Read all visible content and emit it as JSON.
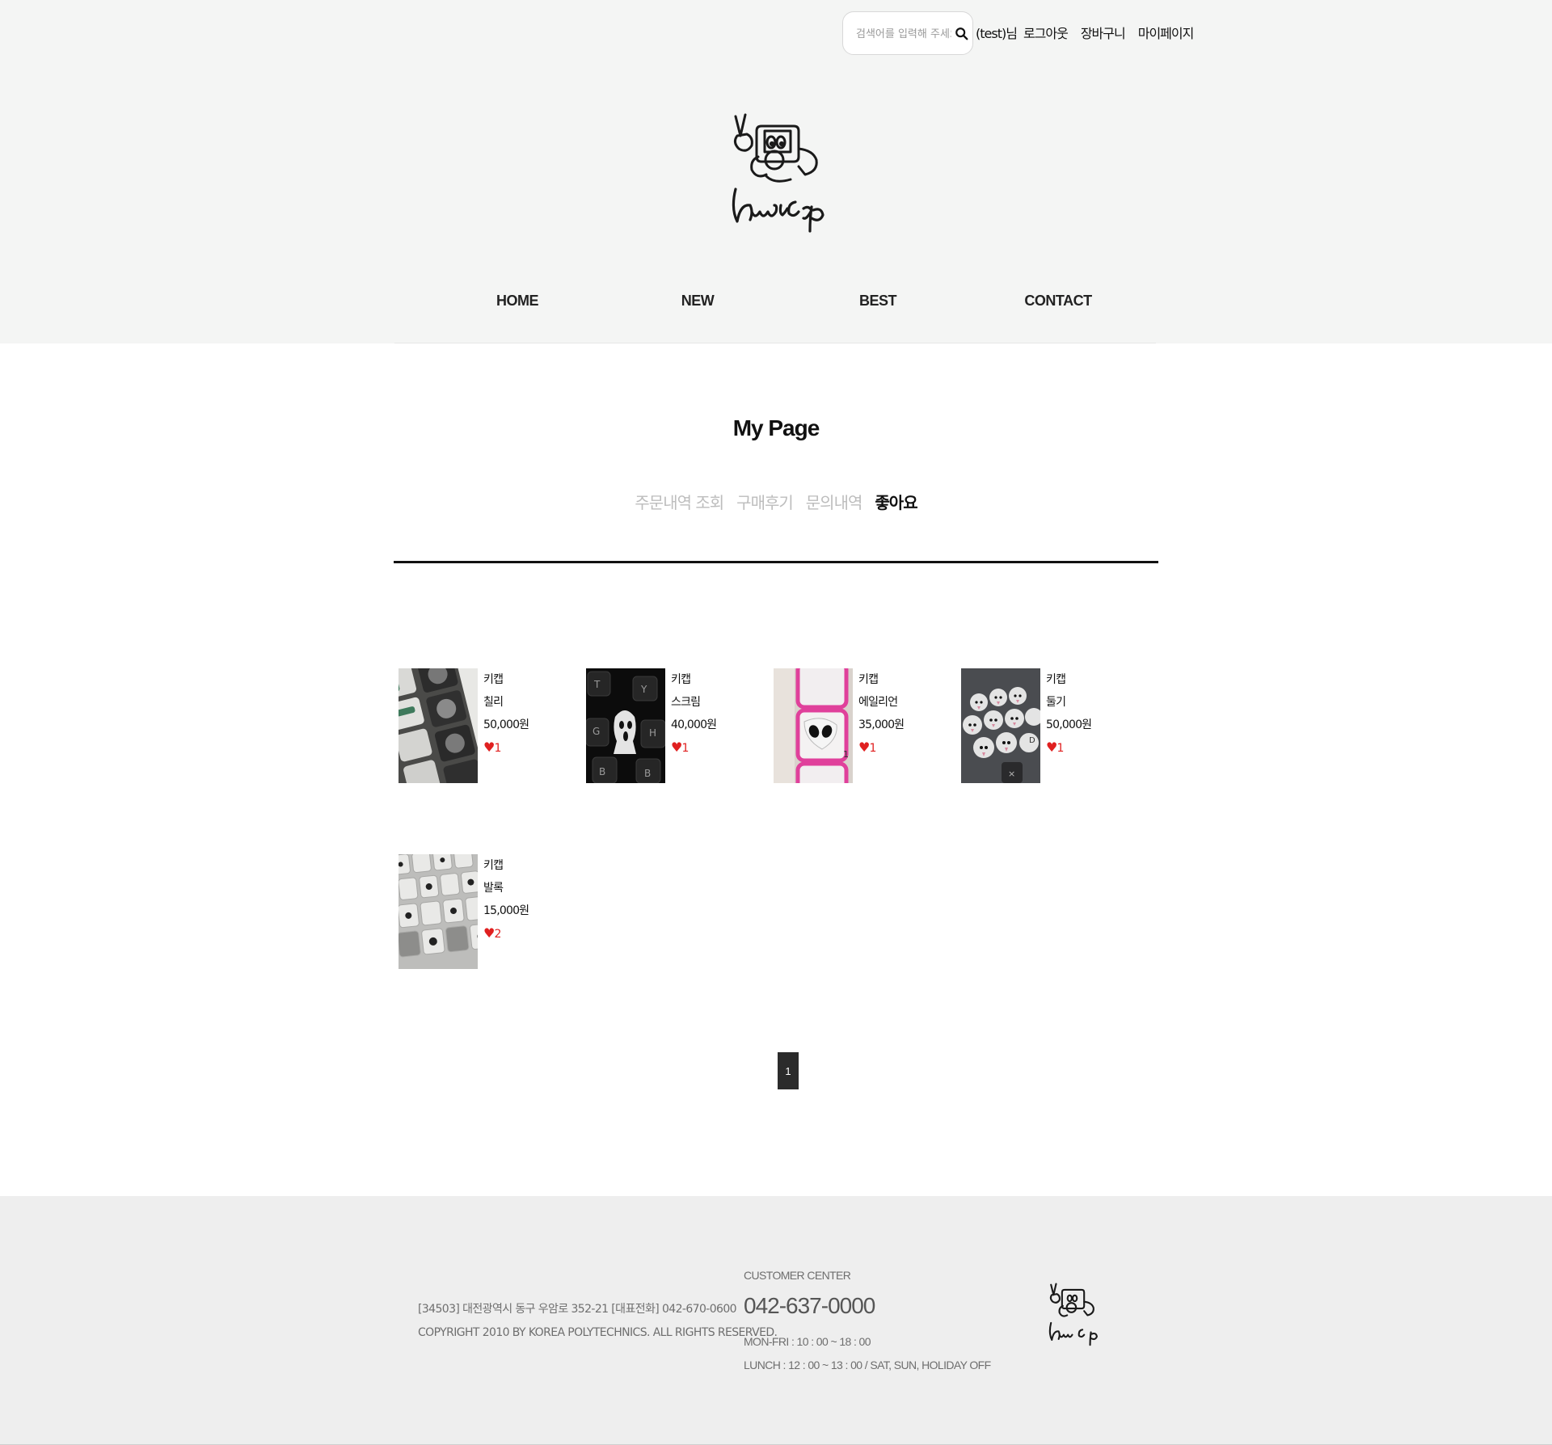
{
  "header": {
    "search_placeholder": "검색어를 입력해 주세요",
    "user_label": "(test)님",
    "links": [
      "로그아웃",
      "장바구니",
      "마이페이지"
    ],
    "logo_text": "hwicap"
  },
  "nav": [
    "HOME",
    "NEW",
    "BEST",
    "CONTACT"
  ],
  "mypage": {
    "title": "My Page",
    "tabs": [
      "주문내역 조회",
      "구매후기",
      "문의내역",
      "좋아요"
    ],
    "active_tab": "좋아요"
  },
  "products": [
    {
      "category": "키캡",
      "name": "칠리",
      "price": "50,000원",
      "likes": "1",
      "image": "keycap-photo-chili"
    },
    {
      "category": "키캡",
      "name": "스크림",
      "price": "40,000원",
      "likes": "1",
      "image": "keycap-photo-scream"
    },
    {
      "category": "키캡",
      "name": "에일리언",
      "price": "35,000원",
      "likes": "1",
      "image": "keycap-photo-alien"
    },
    {
      "category": "키캡",
      "name": "둘기",
      "price": "50,000원",
      "likes": "1",
      "image": "keycap-photo-dulgi"
    },
    {
      "category": "키캡",
      "name": "발록",
      "price": "15,000원",
      "likes": "2",
      "image": "keycap-photo-balrog"
    }
  ],
  "pagination": {
    "current": "1"
  },
  "footer": {
    "address": "[34503] 대전광역시 동구 우암로 352-21 [대표전화] 042-670-0600",
    "copyright": "COPYRIGHT 2010 BY KOREA POLYTECHNICS. ALL RIGHTS RESERVED.",
    "cc_label": "CUSTOMER CENTER",
    "phone": "042-637-0000",
    "hours": "MON-FRI : 10 : 00 ~ 18 : 00",
    "lunch": "LUNCH : 12 : 00 ~ 13 : 00 / SAT, SUN, HOLIDAY OFF"
  },
  "colors": {
    "header_bg": "#f4f5f4",
    "footer_bg": "#eeeeee",
    "like_red": "#e02020",
    "pager_bg": "#2b2b2b"
  }
}
